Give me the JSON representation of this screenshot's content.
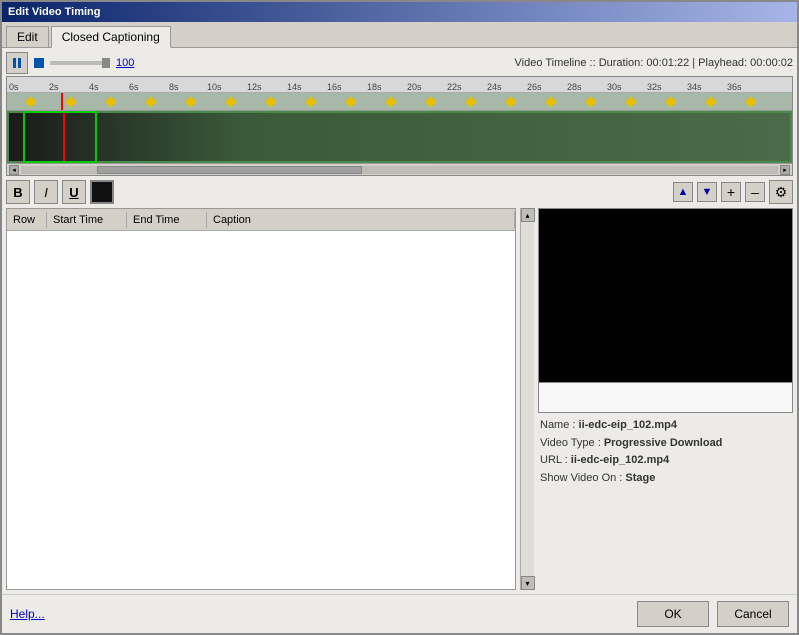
{
  "window": {
    "title": "Edit Video Timing"
  },
  "tabs": [
    {
      "id": "edit",
      "label": "Edit"
    },
    {
      "id": "closed-captioning",
      "label": "Closed Captioning",
      "active": true
    }
  ],
  "timeline": {
    "info": "Video Timeline :: Duration: 00:01:22  |  Playhead: 00:00:02",
    "zoom_value": "100",
    "ruler_marks": [
      "0s",
      "2s",
      "4s",
      "6s",
      "8s",
      "10s",
      "12s",
      "14s",
      "16s",
      "18s",
      "20s",
      "22s",
      "24s",
      "26s",
      "28s",
      "30s",
      "32s",
      "34s",
      "36s"
    ]
  },
  "toolbar": {
    "bold_label": "B",
    "italic_label": "I",
    "underline_label": "U",
    "gear_label": "⚙",
    "add_label": "+",
    "remove_label": "–"
  },
  "table": {
    "columns": [
      "Row",
      "Start Time",
      "End Time",
      "Caption"
    ],
    "rows": []
  },
  "video_meta": {
    "name_label": "Name : ",
    "name_value": "ii-edc-eip_102.mp4",
    "type_label": "Video Type : ",
    "type_value": "Progressive Download",
    "url_label": "URL : ",
    "url_value": "ii-edc-eip_102.mp4",
    "show_label": "Show Video On : ",
    "show_value": "Stage"
  },
  "footer": {
    "help_label": "Help...",
    "ok_label": "OK",
    "cancel_label": "Cancel"
  }
}
